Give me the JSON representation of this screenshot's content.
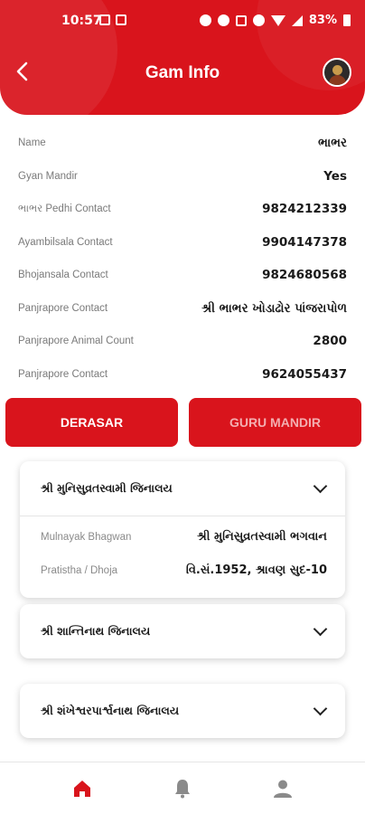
{
  "status_bar": {
    "time": "10:57",
    "battery": "83%"
  },
  "header": {
    "title": "Gam Info",
    "back_icon": "back-arrow-icon",
    "avatar_icon": "avatar"
  },
  "colors": {
    "primary": "#d9141c",
    "label": "#7a7a7a",
    "value": "#1a1a1a"
  },
  "info": [
    {
      "label": "Name",
      "value": "ભાભર"
    },
    {
      "label": "Gyan Mandir",
      "value": "Yes"
    },
    {
      "label": "ભાભર Pedhi Contact",
      "value": "9824212339"
    },
    {
      "label": "Ayambilsala Contact",
      "value": "9904147378"
    },
    {
      "label": "Bhojansala Contact",
      "value": "9824680568"
    },
    {
      "label": "Panjrapore Contact",
      "value": "શ્રી ભાભર ખોડાઢોર પાંજરાપોળ"
    },
    {
      "label": "Panjrapore Animal Count",
      "value": "2800"
    },
    {
      "label": "Panjrapore Contact",
      "value": "9624055437"
    }
  ],
  "tabs": {
    "derasar": "DERASAR",
    "guru_mandir": "GURU MANDIR"
  },
  "derasars": [
    {
      "title": "શ્રી મુનિસુવ્રતસ્વામી જિનાલય",
      "expanded": true,
      "details": [
        {
          "label": "Mulnayak Bhagwan",
          "value": "શ્રી મુનિસુવ્રતસ્વામી ભગવાન"
        },
        {
          "label": "Pratistha / Dhoja",
          "value": "વિ.સં.1952, શ્રાવણ સુદ-10"
        }
      ]
    },
    {
      "title": "શ્રી શાન્તિનાથ જિનાલય",
      "expanded": false
    },
    {
      "title": "શ્રી શંખેશ્વરપાર્શ્વનાથ જિનાલય",
      "expanded": false
    }
  ],
  "bottom_nav": {
    "items": [
      "home-icon",
      "bell-icon",
      "profile-icon"
    ],
    "active": "home-icon",
    "active_color": "#d9141c",
    "inactive_color": "#8a8a8a"
  }
}
